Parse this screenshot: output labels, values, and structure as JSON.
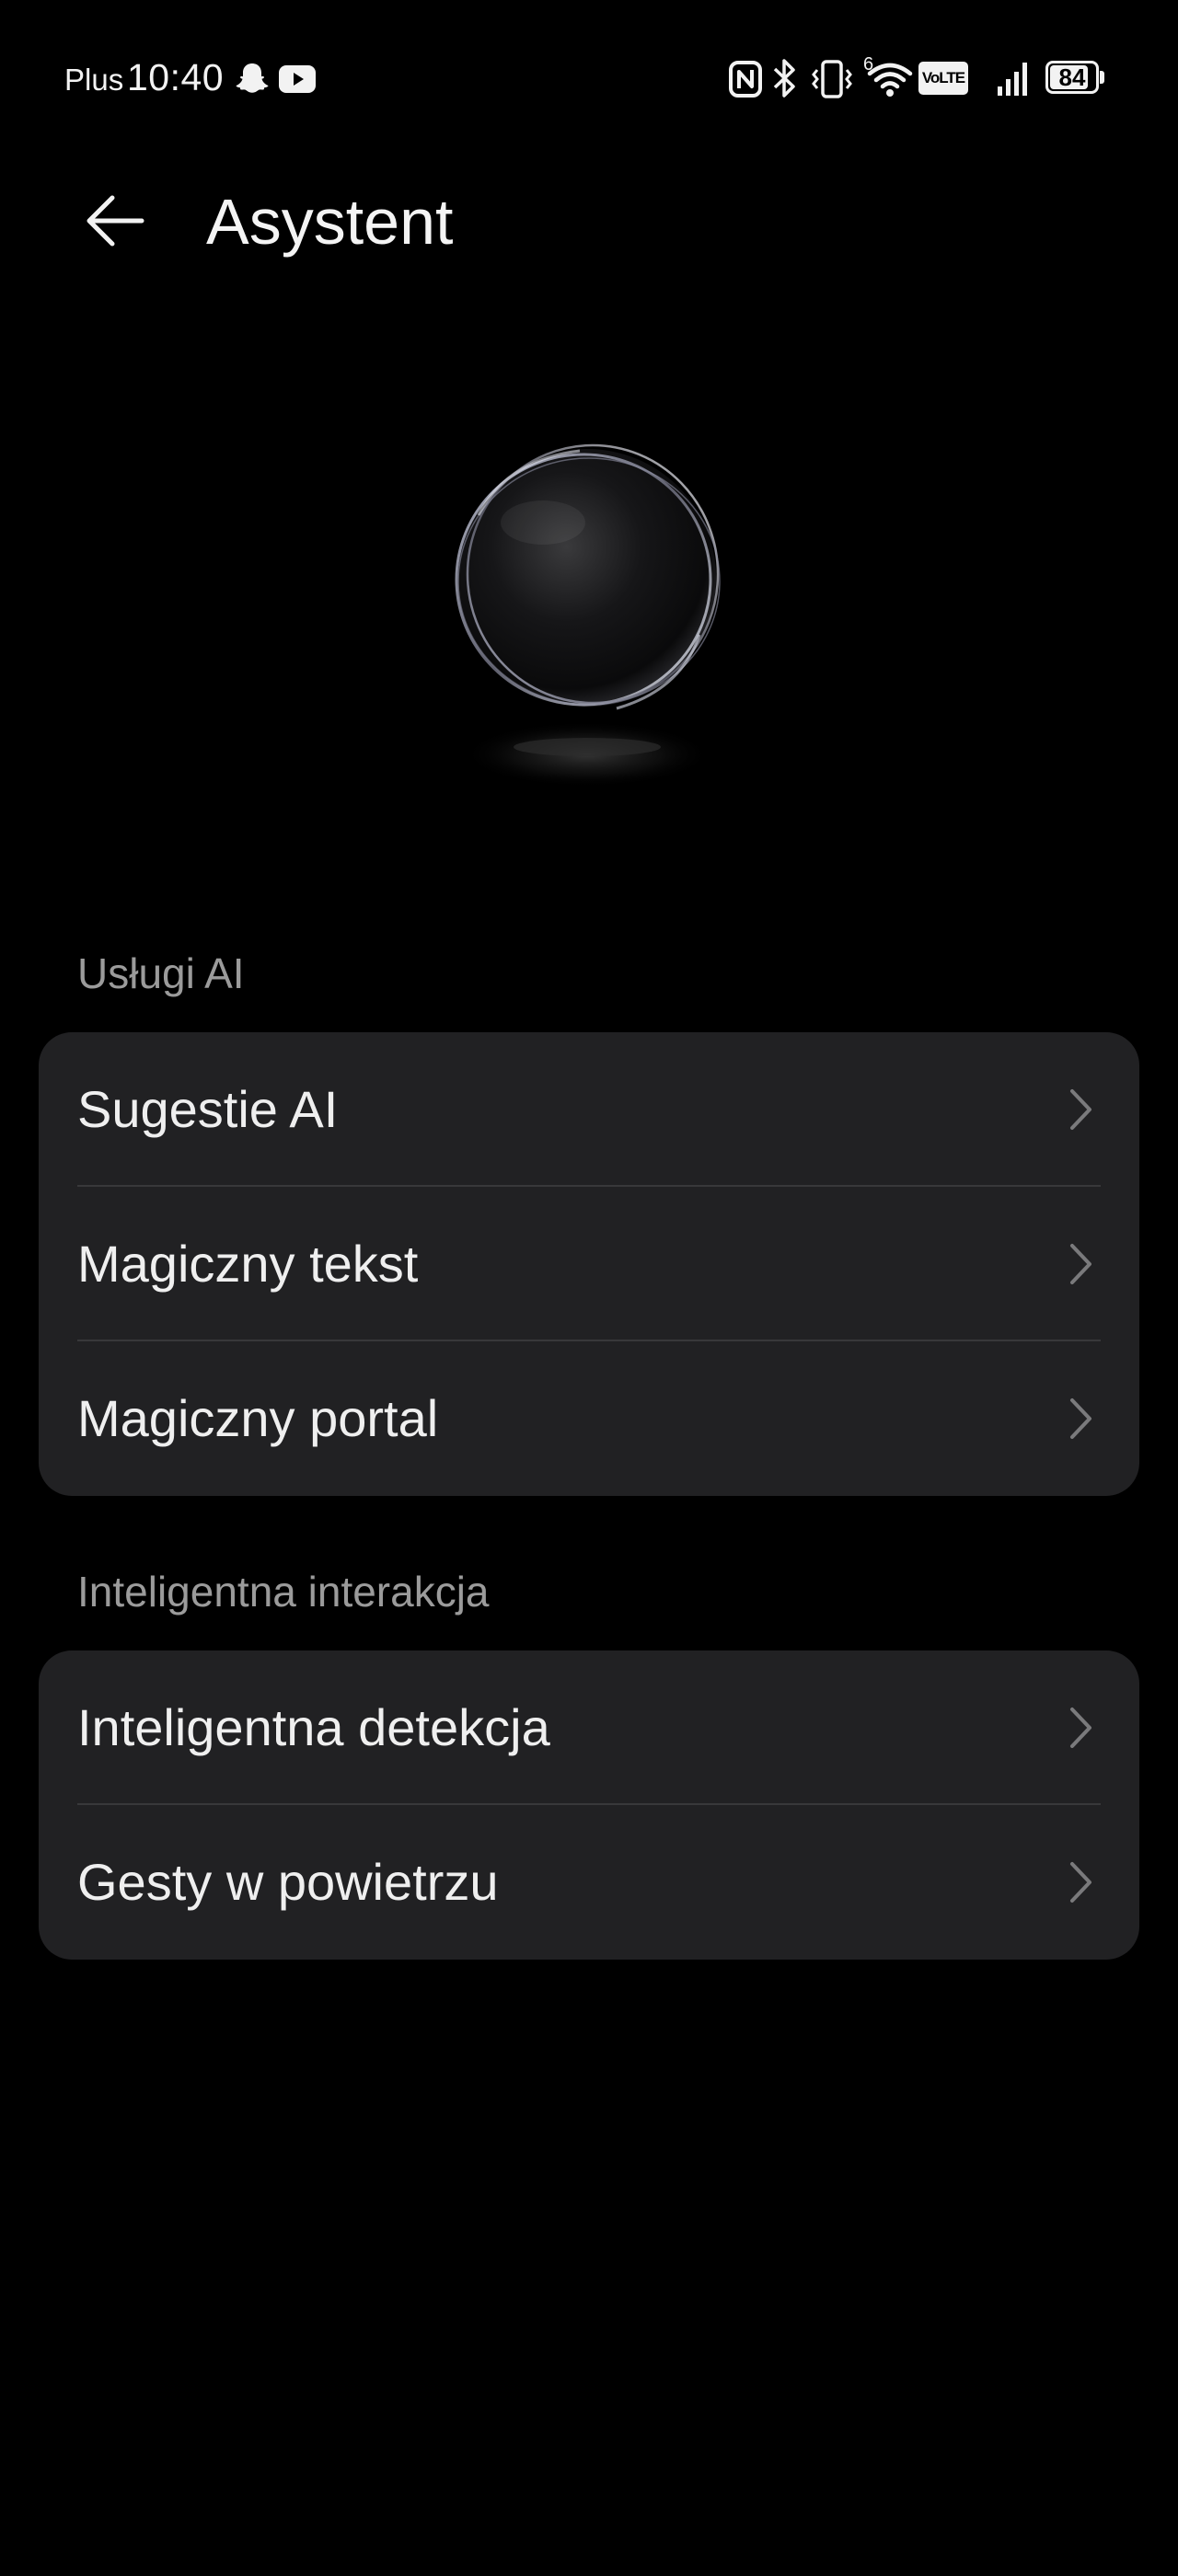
{
  "status_bar": {
    "carrier": "Plus",
    "time": "10:40",
    "network_gen": "6",
    "volte_label": "VoLTE",
    "battery_level": "84",
    "icons": [
      "snapchat-icon",
      "youtube-icon",
      "nfc-icon",
      "bluetooth-icon",
      "vibrate-icon",
      "wifi-icon",
      "volte-icon",
      "signal-icon",
      "battery-icon"
    ]
  },
  "header": {
    "back_icon": "arrow-left-icon",
    "title": "Asystent"
  },
  "hero": {
    "icon": "assistant-orb-icon"
  },
  "sections": [
    {
      "title": "Usługi AI",
      "items": [
        {
          "label": "Sugestie AI"
        },
        {
          "label": "Magiczny tekst"
        },
        {
          "label": "Magiczny portal"
        }
      ]
    },
    {
      "title": "Inteligentna interakcja",
      "items": [
        {
          "label": "Inteligentna detekcja"
        },
        {
          "label": "Gesty w powietrzu"
        }
      ]
    }
  ],
  "colors": {
    "background": "#000000",
    "card": "#212123",
    "divider": "#38383a",
    "section_title": "#9b9b9b",
    "text": "#efefef"
  }
}
